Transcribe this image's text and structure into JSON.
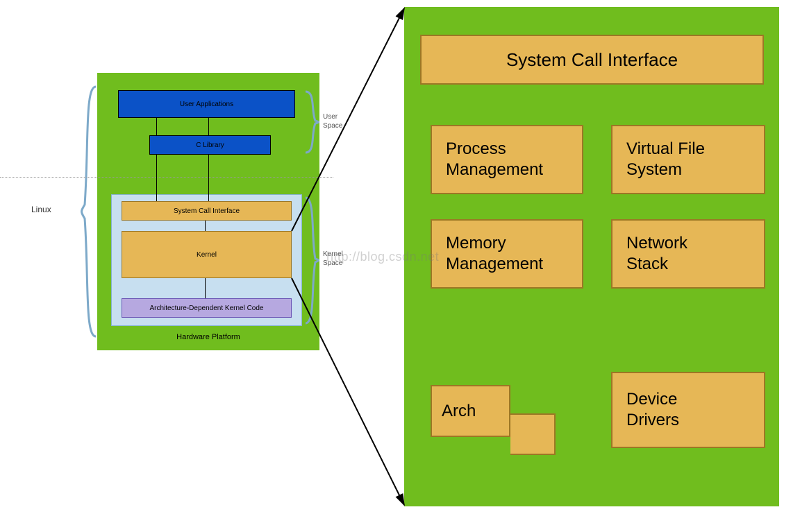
{
  "labels": {
    "linux": "Linux"
  },
  "left": {
    "user_apps": "User Applications",
    "c_library": "C Library",
    "sci": "System Call Interface",
    "kernel": "Kernel",
    "arch_code": "Architecture-Dependent Kernel Code",
    "hw_platform": "Hardware Platform",
    "user_space": "User\nSpace",
    "kernel_space": "Kernel\nSpace"
  },
  "right": {
    "sci": "System Call Interface",
    "process_mgmt": "Process\nManagement",
    "vfs": "Virtual File\nSystem",
    "mem_mgmt": "Memory\nManagement",
    "net_stack": "Network\nStack",
    "arch": "Arch",
    "device_drivers": "Device\nDrivers"
  },
  "watermark": "http://blog.csdn.net"
}
